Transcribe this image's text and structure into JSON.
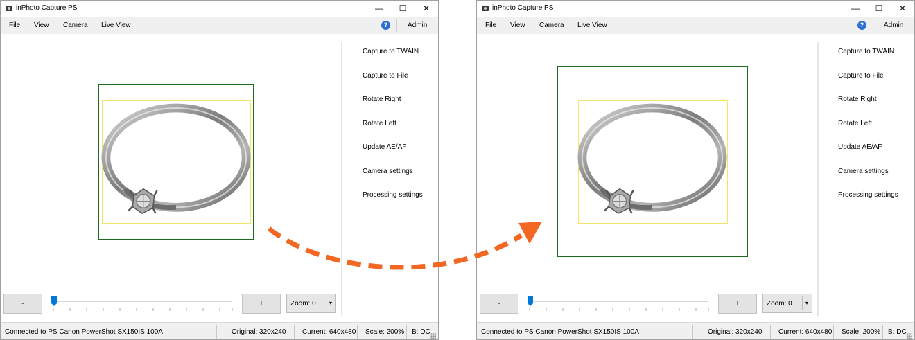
{
  "window": {
    "title": "inPhoto Capture PS",
    "controls": {
      "minimize": "—",
      "maximize": "☐",
      "close": "✕"
    }
  },
  "menu": {
    "items": [
      {
        "first": "F",
        "rest": "ile"
      },
      {
        "first": "V",
        "rest": "iew"
      },
      {
        "first": "C",
        "rest": "amera"
      },
      {
        "first": "L",
        "rest": "ive View"
      }
    ],
    "help_icon": "?",
    "admin": "Admin"
  },
  "side_menu": {
    "items": [
      "Capture to TWAIN",
      "Capture to File",
      "Rotate Right",
      "Rotate Left",
      "Update AE/AF",
      "Camera settings",
      "Processing settings"
    ]
  },
  "controls": {
    "minus_label": "-",
    "plus_label": "+",
    "zoom_label": "Zoom: 0",
    "slider_level": 0
  },
  "status": {
    "connection": "Connected to PS Canon PowerShot SX150IS 100A",
    "original": "Original: 320x240",
    "current": "Current: 640x480",
    "scale": "Scale: 200%",
    "b": "B: DC"
  },
  "colors": {
    "frame_box": "#1e6b1e",
    "crop_box": "#f5e66a",
    "arrow": "#f26722",
    "help_icon": "#2f6fd0",
    "slider_thumb": "#0078d7"
  },
  "icons": {
    "app": "camera-icon",
    "help": "help-icon",
    "zoom_dropdown": "chevron-down-icon",
    "transition": "dashed-curved-arrow-icon"
  }
}
